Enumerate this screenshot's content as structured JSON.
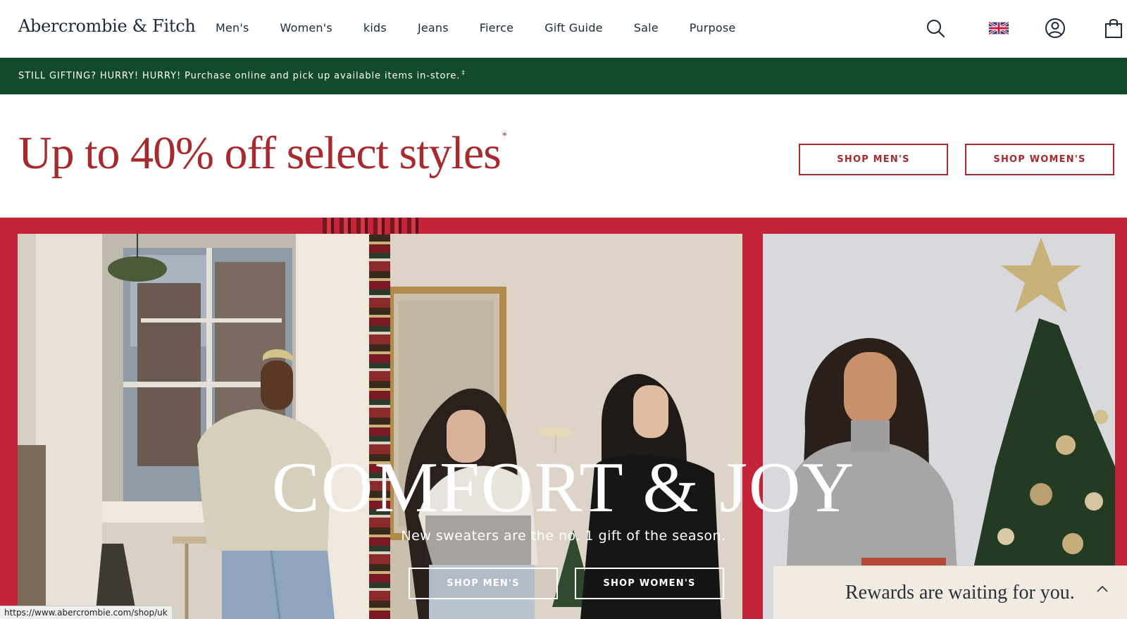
{
  "header": {
    "logo": "Abercrombie & Fitch",
    "nav": [
      "Men's",
      "Women's",
      "kids",
      "Jeans",
      "Fierce",
      "Gift Guide",
      "Sale",
      "Purpose"
    ],
    "icons": [
      "search-icon",
      "uk-flag-icon",
      "account-icon",
      "shopping-bag-icon"
    ]
  },
  "promo": {
    "text": "STILL GIFTING? HURRY! HURRY! Purchase online and pick up available items in-store.",
    "marker": "‡"
  },
  "sale": {
    "headline": "Up to 40% off select styles",
    "asterisk": "*",
    "shop_mens": "SHOP MEN'S",
    "shop_womens": "SHOP WOMEN'S"
  },
  "hero": {
    "title": "COMFORT & JOY",
    "subtitle": "New sweaters are the no. 1 gift of the season.",
    "shop_mens": "SHOP MEN'S",
    "shop_womens": "SHOP WOMEN'S"
  },
  "rewards": {
    "text": "Rewards are waiting for you."
  },
  "status_bar": {
    "url": "https://www.abercrombie.com/shop/uk"
  },
  "colors": {
    "brand_red": "#a72a2f",
    "promo_green": "#134a2c",
    "hero_red": "#c3243a"
  }
}
